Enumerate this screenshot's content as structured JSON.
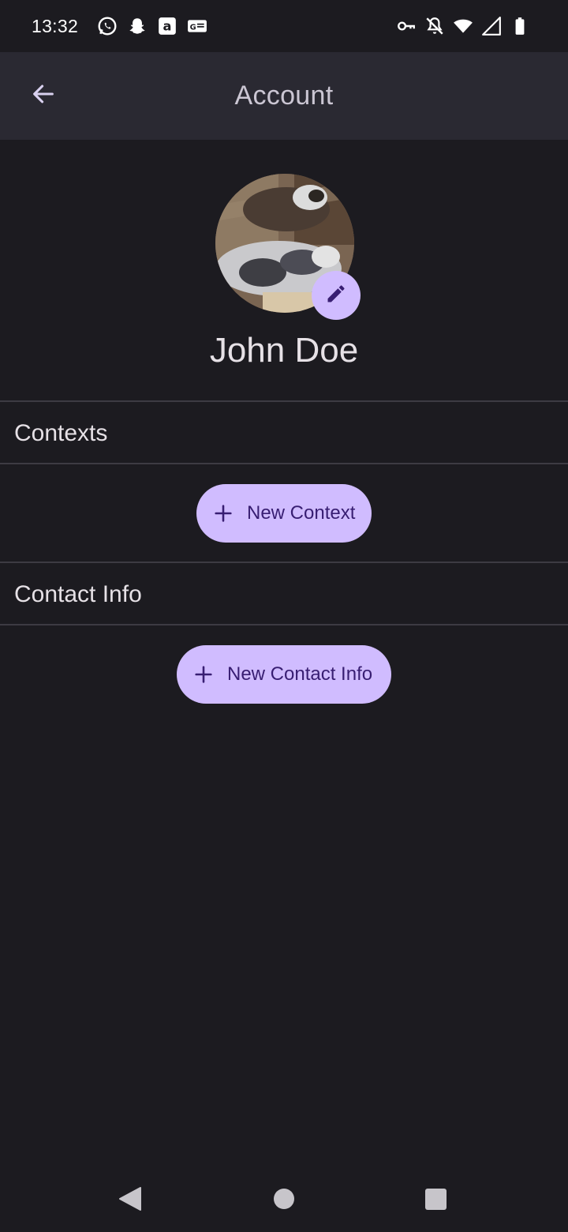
{
  "status_bar": {
    "time": "13:32",
    "left_icons": [
      "whatsapp-icon",
      "snapchat-icon",
      "amazon-icon",
      "gmail-badge-icon"
    ],
    "right_icons": [
      "vpn-key-icon",
      "notifications-off-icon",
      "wifi-icon",
      "signal-icon",
      "battery-icon"
    ]
  },
  "app_bar": {
    "title": "Account",
    "back_icon": "arrow-back-icon"
  },
  "profile": {
    "name": "John Doe",
    "edit_icon": "pencil-icon"
  },
  "sections": {
    "contexts": {
      "header": "Contexts",
      "button_label": "New Context"
    },
    "contact_info": {
      "header": "Contact Info",
      "button_label": "New Contact Info"
    }
  },
  "colors": {
    "background": "#1c1b20",
    "app_bar": "#2a2932",
    "accent": "#d0bcff",
    "on_accent": "#381e72",
    "divider": "#3d3b43"
  },
  "nav_bar": {
    "icons": [
      "nav-back-icon",
      "nav-home-icon",
      "nav-recents-icon"
    ]
  }
}
